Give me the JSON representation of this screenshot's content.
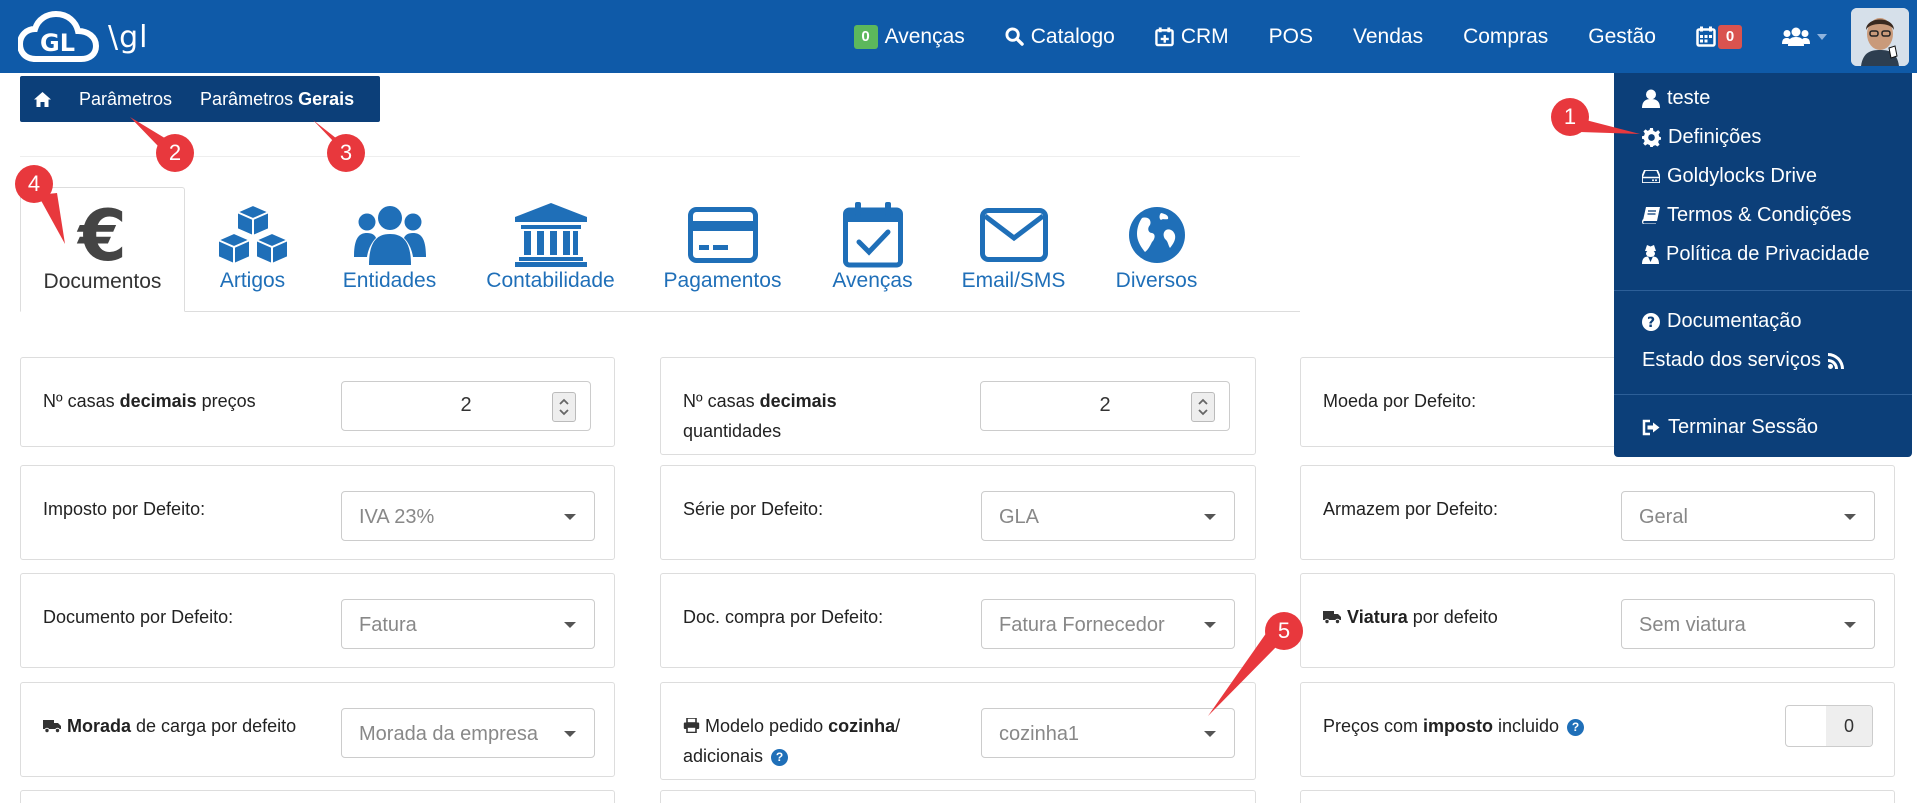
{
  "navbar": {
    "brand_text": "\\gl",
    "avencas_count": "0",
    "avencas_label": "Avenças",
    "catalogo_label": "Catalogo",
    "crm_label": "CRM",
    "pos_label": "POS",
    "vendas_label": "Vendas",
    "compras_label": "Compras",
    "gestao_label": "Gestão",
    "calendar_count": "0",
    "icons": [
      "cloud-logo-icon",
      "search-icon",
      "calendar-plus-icon",
      "calendar-icon",
      "users-icon",
      "user-avatar"
    ]
  },
  "breadcrumb": {
    "item1": "Parâmetros",
    "item2_prefix": "Parâmetros",
    "item2_bold": "Gerais"
  },
  "tabs": [
    {
      "label": "Documentos",
      "icon": "euro-icon",
      "glyph": "€",
      "active": true
    },
    {
      "label": "Artigos",
      "icon": "cubes-icon"
    },
    {
      "label": "Entidades",
      "icon": "users-icon"
    },
    {
      "label": "Contabilidade",
      "icon": "bank-icon"
    },
    {
      "label": "Pagamentos",
      "icon": "credit-card-icon"
    },
    {
      "label": "Avenças",
      "icon": "calendar-check-icon"
    },
    {
      "label": "Email/SMS",
      "icon": "envelope-icon"
    },
    {
      "label": "Diversos",
      "icon": "globe-icon"
    }
  ],
  "fields": {
    "casas_precos": {
      "pre": "Nº casas ",
      "bold": "decimais",
      "post": " preços",
      "value": "2"
    },
    "casas_quant": {
      "pre": "Nº casas ",
      "bold": "decimais",
      "post": "quantidades",
      "value": "2"
    },
    "moeda": {
      "label": "Moeda por Defeito:"
    },
    "imposto": {
      "label": "Imposto por Defeito:",
      "value": "IVA 23%"
    },
    "serie": {
      "label": "Série por Defeito:",
      "value": "GLA"
    },
    "armazem": {
      "label": "Armazem por Defeito:",
      "value": "Geral"
    },
    "documento": {
      "label": "Documento por Defeito:",
      "value": "Fatura"
    },
    "doc_compra": {
      "label": "Doc. compra por Defeito:",
      "value": "Fatura Fornecedor"
    },
    "viatura": {
      "bold": "Viatura",
      "post": " por defeito",
      "value": "Sem viatura"
    },
    "morada": {
      "bold": "Morada",
      "post": " de carga por defeito",
      "value": "Morada da empresa"
    },
    "modelo": {
      "pre": "Modelo pedido ",
      "bold": "cozinha",
      "post1": "/",
      "post2": "adicionais",
      "value": "cozinha1"
    },
    "precos_imposto": {
      "pre": "Preços com ",
      "bold": "imposto",
      "post": " incluido",
      "toggle_value": "0"
    }
  },
  "dropdown": {
    "user": "teste",
    "definicoes": "Definições",
    "drive": "Goldylocks Drive",
    "termos": "Termos & Condições",
    "privacidade": "Política de Privacidade",
    "documentacao": "Documentação",
    "estado": "Estado dos serviços",
    "logout": "Terminar Sessão"
  },
  "annotations": [
    "1",
    "2",
    "3",
    "4",
    "5"
  ],
  "colors": {
    "navbar": "#0f5aa8",
    "dark_blue": "#0c3f79",
    "accent_blue": "#1f6fb8",
    "badge_green": "#5cb85c",
    "badge_red": "#d9534f",
    "annotation_red": "#e8383d"
  }
}
